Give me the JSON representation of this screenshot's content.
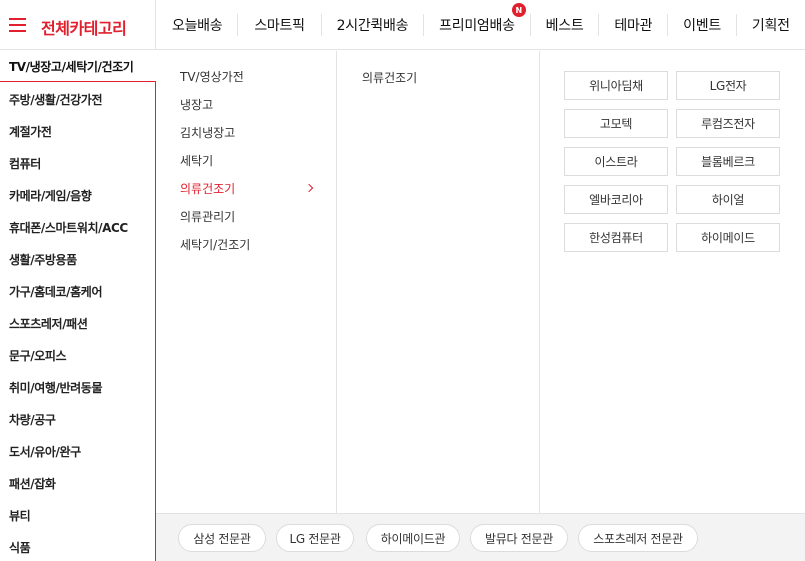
{
  "header": {
    "category_title": "전체카테고리",
    "nav": [
      {
        "label": "오늘배송"
      },
      {
        "label": "스마트픽"
      },
      {
        "label": "2시간퀵배송"
      },
      {
        "label": "프리미엄배송",
        "badge": "N"
      },
      {
        "label": "베스트"
      },
      {
        "label": "테마관"
      },
      {
        "label": "이벤트"
      },
      {
        "label": "기획전"
      }
    ]
  },
  "categories": {
    "active": "TV/냉장고/세탁기/건조기",
    "items": [
      "주방/생활/건강가전",
      "계절가전",
      "컴퓨터",
      "카메라/게임/음향",
      "휴대폰/스마트워치/ACC",
      "생활/주방용품",
      "가구/홈데코/홈케어",
      "스포츠레저/패션",
      "문구/오피스",
      "취미/여행/반려동물",
      "차량/공구",
      "도서/유아/완구",
      "패션/잡화",
      "뷰티",
      "식품"
    ]
  },
  "subcategories": {
    "items": [
      "TV/영상가전",
      "냉장고",
      "김치냉장고",
      "세탁기",
      "의류건조기",
      "의류관리기",
      "세탁기/건조기"
    ],
    "active_index": 4
  },
  "third_level": {
    "items": [
      "의류건조기"
    ]
  },
  "brands": [
    "위니아딤채",
    "LG전자",
    "고모텍",
    "루컴즈전자",
    "이스트라",
    "블롬베르크",
    "엘바코리아",
    "하이얼",
    "한성컴퓨터",
    "하이메이드"
  ],
  "brand_shops": [
    "삼성 전문관",
    "LG 전문관",
    "하이메이드관",
    "발뮤다 전문관",
    "스포츠레저 전문관"
  ],
  "colors": {
    "accent": "#e1202e",
    "border": "#e3e3e3",
    "footer_bg": "#f3f3f3"
  }
}
